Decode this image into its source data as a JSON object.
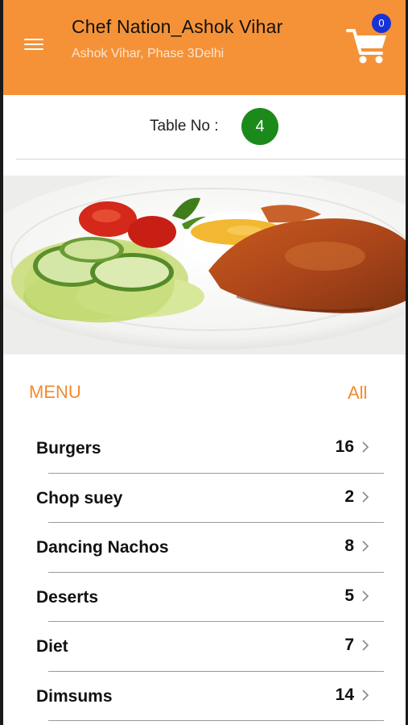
{
  "header": {
    "title": "Chef Nation_Ashok Vihar",
    "subtitle": "Ashok Vihar, Phase 3Delhi",
    "cart_count": "0",
    "accent_color": "#F59238"
  },
  "table": {
    "label": "Table No :",
    "number": "4"
  },
  "hero": {
    "image": "plate-of-grilled-chicken-with-salad-and-dip"
  },
  "menu": {
    "heading": "MENU",
    "all_label": "All",
    "items": [
      {
        "name": "Burgers",
        "count": "16"
      },
      {
        "name": "Chop suey",
        "count": "2"
      },
      {
        "name": "Dancing Nachos",
        "count": "8"
      },
      {
        "name": "Deserts",
        "count": "5"
      },
      {
        "name": "Diet",
        "count": "7"
      },
      {
        "name": "Dimsums",
        "count": "14"
      }
    ]
  },
  "icons": {
    "menu": "hamburger-menu-icon",
    "cart": "shopping-cart-icon",
    "chevron": "chevron-right-icon"
  }
}
